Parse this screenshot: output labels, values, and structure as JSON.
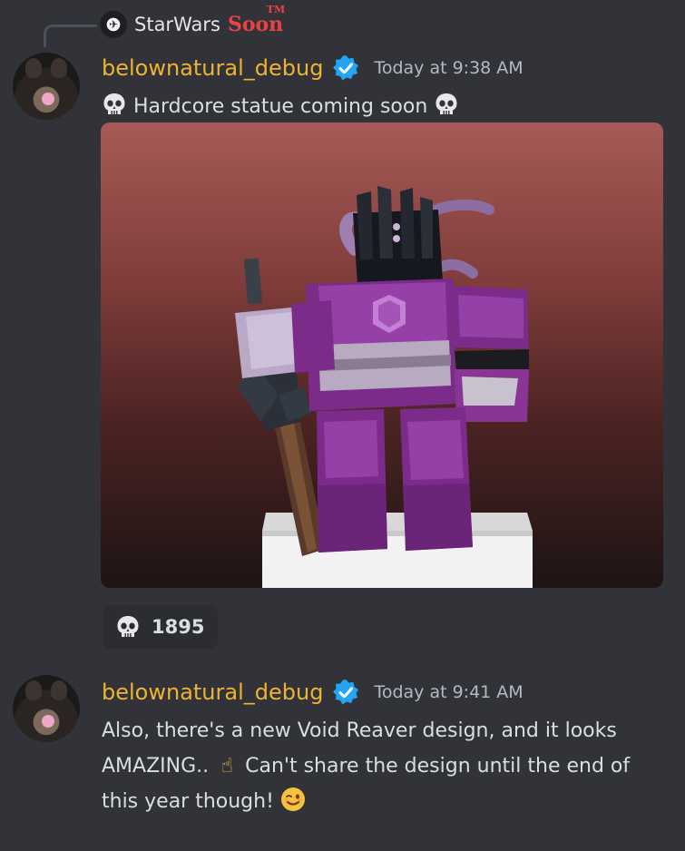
{
  "reply": {
    "server_name": "StarWars",
    "server_tag": "Soon",
    "tm": "TM"
  },
  "messages": [
    {
      "username": "belownatural_debug",
      "timestamp": "Today at 9:38 AM",
      "text": "Hardcore statue coming soon",
      "reaction": {
        "emoji": "skull-icon",
        "count": "1895"
      }
    },
    {
      "username": "belownatural_debug",
      "timestamp": "Today at 9:41 AM",
      "line1": "Also, there's a new Void Reaver design, and it looks",
      "line2_a": "AMAZING..",
      "line2_b": "Can't share the design until the end of",
      "line3": "this year though!"
    }
  ],
  "colors": {
    "background": "#313338",
    "username": "#f0b232",
    "verified": "#23a5f5",
    "timestamp": "#b5bac1",
    "text": "#dbdee1"
  }
}
